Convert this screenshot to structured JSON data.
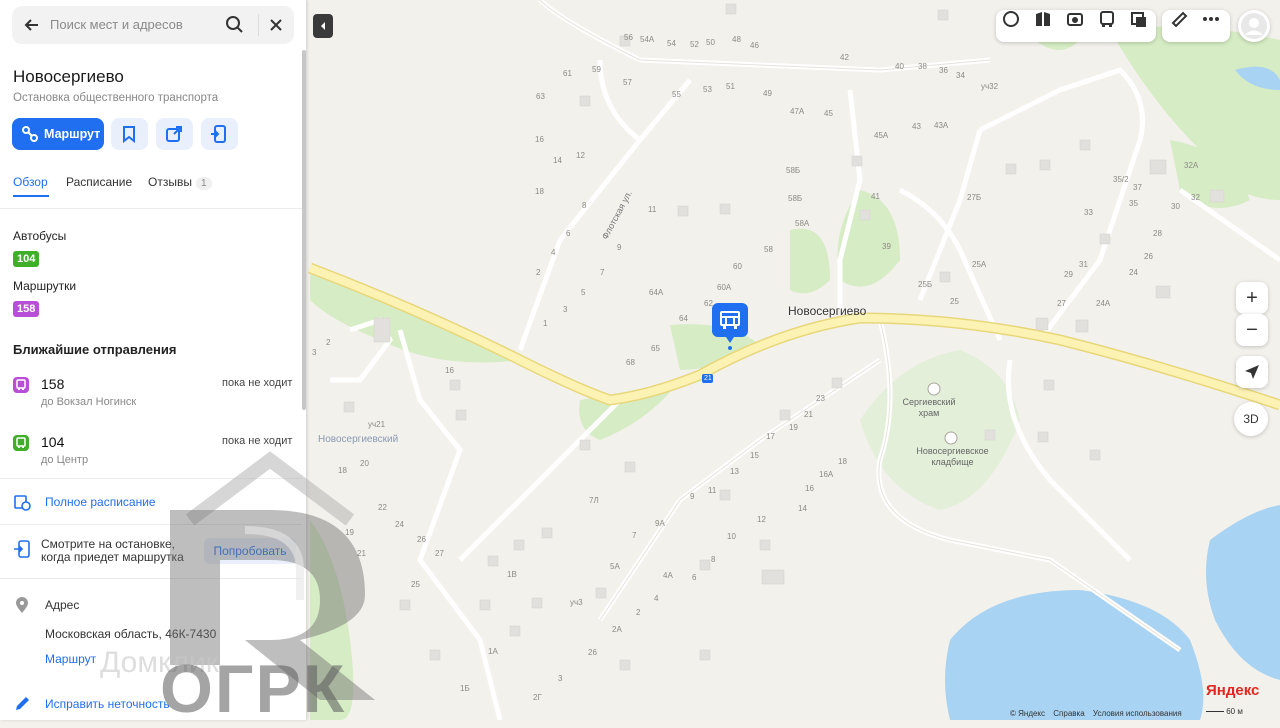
{
  "search": {
    "placeholder": "Поиск мест и адресов"
  },
  "place": {
    "title": "Новосергиево",
    "subtitle": "Остановка общественного транспорта",
    "route_button": "Маршрут"
  },
  "tabs": [
    {
      "label": "Обзор",
      "active": true
    },
    {
      "label": "Расписание"
    },
    {
      "label": "Отзывы",
      "count": "1"
    }
  ],
  "transport": {
    "buses_label": "Автобусы",
    "bus_route": "104",
    "bus_color": "#3fae29",
    "minibus_label": "Маршрутки",
    "minibus_route": "158",
    "minibus_color": "#b94fd6"
  },
  "departures": {
    "heading": "Ближайшие отправления",
    "items": [
      {
        "route": "158",
        "destination": "до Вокзал Ногинск",
        "status": "пока не ходит",
        "color": "#b94fd6"
      },
      {
        "route": "104",
        "destination": "до Центр",
        "status": "пока не ходит",
        "color": "#3fae29"
      }
    ]
  },
  "full_schedule": "Полное расписание",
  "promo": {
    "text_line1": "Смотрите на остановке,",
    "text_line2": "когда приедет маршрутка",
    "button": "Попробовать"
  },
  "address": {
    "label": "Адрес",
    "value": "Московская область, 46К-7430",
    "route_link": "Маршрут"
  },
  "fix_link": "Исправить неточность",
  "watermark": {
    "text": "ОГРК",
    "domclick": "Домклик"
  },
  "map": {
    "stop_name": "Новосергиево",
    "places": [
      {
        "name": "Новосергиевский",
        "blue": true
      },
      {
        "name": "Сергиевский храм"
      },
      {
        "name": "Новосергиевское кладбище"
      }
    ],
    "street": "Флотская ул.",
    "road_number": "21",
    "house_numbers": [
      "56",
      "54А",
      "54",
      "52",
      "50",
      "48",
      "46",
      "42",
      "40",
      "38",
      "36",
      "34",
      "уч32",
      "61",
      "59",
      "57",
      "55",
      "53",
      "51",
      "49",
      "63",
      "47А",
      "45",
      "45А",
      "43",
      "43А",
      "16",
      "14",
      "12",
      "18",
      "8",
      "6",
      "4",
      "2",
      "5",
      "3",
      "1",
      "7",
      "9",
      "11",
      "58Б",
      "58Б",
      "58А",
      "58",
      "60",
      "60А",
      "62",
      "64А",
      "64",
      "65",
      "68",
      "41",
      "39",
      "27Б",
      "25А",
      "25Б",
      "25",
      "33",
      "35/2",
      "37",
      "35",
      "32А",
      "30",
      "32",
      "28",
      "26",
      "31",
      "29",
      "24",
      "27",
      "24А",
      "16",
      "2",
      "3",
      "уч21",
      "20",
      "18",
      "22",
      "24",
      "19",
      "26",
      "27",
      "21",
      "25",
      "1В",
      "5А",
      "уч3",
      "4А",
      "6",
      "2А",
      "2",
      "4",
      "1А",
      "26",
      "3",
      "1Б",
      "2Г",
      "7Л",
      "9",
      "11",
      "9А",
      "7",
      "8",
      "10",
      "12",
      "13",
      "15",
      "17",
      "19",
      "21",
      "23",
      "16А",
      "18",
      "16",
      "14"
    ],
    "logo": "Яндекс",
    "copyright": [
      "© Яндекс",
      "Справка",
      "Условия использования"
    ],
    "scale": "60 м",
    "controls": {
      "zoom_in": "+",
      "zoom_out": "−",
      "three_d": "3D"
    }
  }
}
